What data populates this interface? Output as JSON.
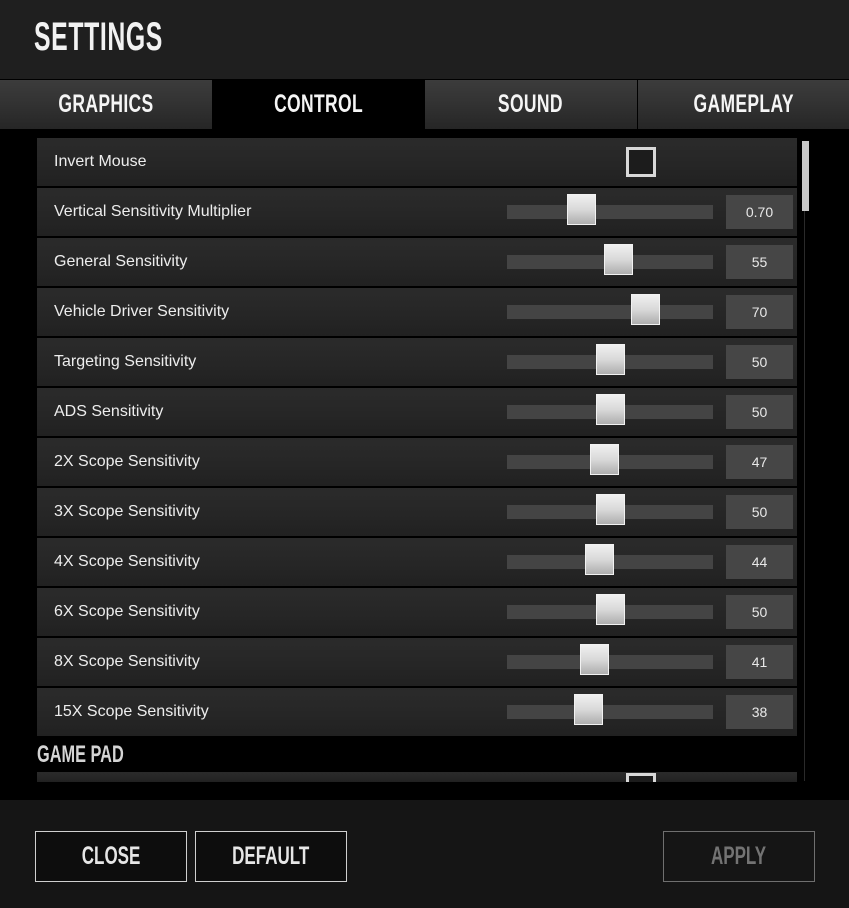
{
  "header": {
    "title": "SETTINGS"
  },
  "tabs": [
    {
      "label": "GRAPHICS",
      "active": false
    },
    {
      "label": "CONTROL",
      "active": true
    },
    {
      "label": "SOUND",
      "active": false
    },
    {
      "label": "GAMEPLAY",
      "active": false
    }
  ],
  "settings": [
    {
      "label": "Invert Mouse",
      "type": "checkbox",
      "checked": false
    },
    {
      "label": "Vertical Sensitivity Multiplier",
      "type": "slider",
      "value": "0.70",
      "position": 34
    },
    {
      "label": "General Sensitivity",
      "type": "slider",
      "value": "55",
      "position": 55
    },
    {
      "label": "Vehicle Driver Sensitivity",
      "type": "slider",
      "value": "70",
      "position": 70
    },
    {
      "label": "Targeting Sensitivity",
      "type": "slider",
      "value": "50",
      "position": 50
    },
    {
      "label": "ADS Sensitivity",
      "type": "slider",
      "value": "50",
      "position": 50
    },
    {
      "label": "2X Scope Sensitivity",
      "type": "slider",
      "value": "47",
      "position": 47
    },
    {
      "label": "3X Scope Sensitivity",
      "type": "slider",
      "value": "50",
      "position": 50
    },
    {
      "label": "4X Scope Sensitivity",
      "type": "slider",
      "value": "44",
      "position": 44
    },
    {
      "label": "6X Scope Sensitivity",
      "type": "slider",
      "value": "50",
      "position": 50
    },
    {
      "label": "8X Scope Sensitivity",
      "type": "slider",
      "value": "41",
      "position": 41
    },
    {
      "label": "15X Scope Sensitivity",
      "type": "slider",
      "value": "38",
      "position": 38
    }
  ],
  "section_gamepad": {
    "label": "GAME PAD"
  },
  "partial_row": {
    "type": "checkbox",
    "checked": false
  },
  "footer": {
    "close_label": "CLOSE",
    "default_label": "DEFAULT",
    "apply_label": "APPLY",
    "apply_disabled": true
  },
  "colors": {
    "background": "#000000",
    "header_bg": "#1f1f1f",
    "row_bg": "#262626",
    "track": "#444444",
    "handle": "#d9d9d9",
    "valuebox": "#464646",
    "text": "#ededed",
    "disabled_text": "#737373",
    "scrollbar": "#c8c8c8"
  }
}
